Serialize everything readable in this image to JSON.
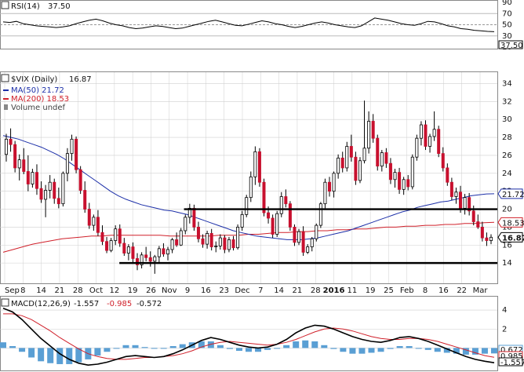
{
  "colors": {
    "up_candle": "#ffffff",
    "down_candle": "#c8102e",
    "candle_outline": "#000000",
    "ma50": "#1c2fa8",
    "ma200": "#d0202a",
    "rsi": "#000000",
    "macd": "#000000",
    "signal": "#d0202a",
    "histogram": "#5a9fd4",
    "support_line": "#000000",
    "grid": "#cfcfcf"
  },
  "rsi_panel": {
    "legend": "RSI(14)",
    "value": "37.50",
    "ylim": [
      10,
      90
    ],
    "yticks": [
      "90",
      "70",
      "50",
      "30",
      "10"
    ],
    "last_tag": "37.50",
    "series": [
      55,
      54,
      56,
      52,
      50,
      48,
      47,
      46,
      45,
      46,
      48,
      52,
      55,
      58,
      60,
      57,
      53,
      50,
      48,
      45,
      43,
      44,
      46,
      48,
      47,
      45,
      43,
      44,
      47,
      50,
      53,
      56,
      58,
      55,
      52,
      49,
      48,
      51,
      54,
      57,
      55,
      52,
      50,
      47,
      45,
      47,
      50,
      53,
      55,
      53,
      50,
      48,
      46,
      45,
      48,
      55,
      62,
      60,
      58,
      55,
      52,
      50,
      49,
      52,
      56,
      55,
      52,
      48,
      46,
      43,
      42,
      40,
      39,
      38,
      37.5
    ]
  },
  "price_panel": {
    "legend_symbol": "$VIX (Daily)",
    "legend_value": "16.87",
    "ma50_legend": "MA(50) 21.72",
    "ma200_legend": "MA(200) 18.53",
    "volume_legend": "Volume undef",
    "ylim": [
      12,
      35
    ],
    "yticks": [
      "34",
      "32",
      "30",
      "28",
      "26",
      "24",
      "22",
      "20",
      "18",
      "16",
      "14"
    ],
    "tags": {
      "ma50": "21.72",
      "ma200": "18.53",
      "last": "16.87"
    },
    "support_lines": [
      {
        "y": 20,
        "from": 0.37,
        "to": 1.0
      },
      {
        "y": 14,
        "from": 0.24,
        "to": 1.0
      }
    ],
    "x_labels": [
      "Sep",
      "8",
      "14",
      "21",
      "28",
      "Oct",
      "12",
      "19",
      "26",
      "Nov",
      "9",
      "16",
      "23",
      "Dec",
      "7",
      "14",
      "21",
      "28",
      "2016",
      "11",
      "19",
      "25",
      "Feb",
      "8",
      "16",
      "22",
      "Mar"
    ],
    "candles": [
      [
        26.1,
        28.4,
        25.3,
        27.8
      ],
      [
        27.8,
        29.0,
        26.4,
        27.2
      ],
      [
        27.2,
        27.6,
        24.1,
        24.6
      ],
      [
        24.6,
        26.1,
        23.2,
        25.5
      ],
      [
        25.5,
        26.8,
        23.9,
        24.2
      ],
      [
        24.2,
        26.0,
        22.0,
        22.8
      ],
      [
        22.8,
        24.5,
        22.4,
        24.1
      ],
      [
        24.1,
        25.0,
        21.6,
        22.3
      ],
      [
        22.3,
        23.1,
        20.7,
        21.1
      ],
      [
        21.1,
        22.7,
        19.1,
        22.1
      ],
      [
        22.1,
        23.8,
        21.2,
        23.0
      ],
      [
        23.0,
        23.4,
        20.6,
        21.2
      ],
      [
        21.2,
        22.4,
        20.1,
        20.6
      ],
      [
        20.6,
        24.2,
        20.3,
        24.0
      ],
      [
        24.0,
        26.8,
        23.1,
        26.2
      ],
      [
        26.2,
        28.3,
        25.4,
        27.8
      ],
      [
        27.8,
        28.1,
        24.0,
        24.4
      ],
      [
        24.4,
        24.8,
        21.7,
        22.1
      ],
      [
        22.1,
        23.1,
        19.6,
        20.0
      ],
      [
        20.0,
        20.7,
        17.8,
        18.2
      ],
      [
        18.2,
        19.4,
        17.6,
        19.1
      ],
      [
        19.1,
        19.9,
        17.0,
        17.4
      ],
      [
        17.4,
        18.2,
        16.0,
        16.4
      ],
      [
        16.4,
        16.9,
        15.1,
        15.4
      ],
      [
        15.4,
        16.8,
        15.2,
        16.5
      ],
      [
        16.5,
        18.2,
        16.0,
        17.8
      ],
      [
        17.8,
        18.3,
        15.8,
        16.2
      ],
      [
        16.2,
        16.8,
        14.8,
        15.1
      ],
      [
        15.1,
        16.1,
        14.3,
        15.8
      ],
      [
        15.8,
        16.3,
        14.0,
        14.5
      ],
      [
        14.5,
        15.1,
        13.2,
        13.8
      ],
      [
        13.8,
        15.2,
        13.4,
        14.9
      ],
      [
        14.9,
        15.8,
        14.2,
        14.6
      ],
      [
        14.6,
        15.3,
        13.6,
        14.2
      ],
      [
        14.2,
        14.9,
        12.8,
        14.7
      ],
      [
        14.7,
        15.9,
        14.1,
        15.6
      ],
      [
        15.6,
        16.2,
        14.7,
        15.0
      ],
      [
        15.0,
        15.8,
        14.3,
        15.5
      ],
      [
        15.5,
        16.8,
        15.1,
        16.6
      ],
      [
        16.6,
        17.4,
        15.8,
        16.0
      ],
      [
        16.0,
        17.9,
        15.9,
        17.6
      ],
      [
        17.6,
        19.4,
        17.2,
        19.1
      ],
      [
        19.1,
        20.6,
        18.4,
        20.1
      ],
      [
        20.1,
        20.5,
        17.6,
        18.0
      ],
      [
        18.0,
        18.6,
        16.3,
        16.7
      ],
      [
        16.7,
        17.2,
        15.7,
        16.1
      ],
      [
        16.1,
        17.6,
        15.6,
        17.3
      ],
      [
        17.3,
        17.8,
        15.4,
        15.8
      ],
      [
        15.8,
        16.4,
        15.2,
        15.9
      ],
      [
        15.9,
        17.2,
        15.5,
        16.8
      ],
      [
        16.8,
        17.1,
        15.1,
        15.5
      ],
      [
        15.5,
        16.9,
        15.2,
        16.6
      ],
      [
        16.6,
        17.0,
        15.4,
        15.7
      ],
      [
        15.7,
        18.3,
        15.5,
        18.0
      ],
      [
        18.0,
        19.8,
        17.6,
        19.4
      ],
      [
        19.4,
        21.6,
        19.1,
        21.3
      ],
      [
        21.3,
        24.2,
        20.8,
        23.6
      ],
      [
        23.6,
        27.0,
        22.7,
        26.4
      ],
      [
        26.4,
        26.8,
        22.5,
        23.0
      ],
      [
        23.0,
        23.4,
        19.2,
        19.6
      ],
      [
        19.6,
        20.3,
        18.4,
        19.0
      ],
      [
        19.0,
        19.4,
        16.8,
        17.2
      ],
      [
        17.2,
        19.8,
        16.9,
        19.5
      ],
      [
        19.5,
        21.9,
        19.1,
        21.4
      ],
      [
        21.4,
        22.2,
        20.2,
        20.6
      ],
      [
        20.6,
        20.9,
        17.6,
        18.0
      ],
      [
        18.0,
        18.3,
        15.9,
        16.3
      ],
      [
        16.3,
        17.8,
        16.0,
        17.5
      ],
      [
        17.5,
        18.1,
        14.8,
        15.2
      ],
      [
        15.2,
        16.1,
        15.0,
        15.8
      ],
      [
        15.8,
        16.9,
        15.3,
        16.7
      ],
      [
        16.7,
        18.4,
        16.4,
        18.2
      ],
      [
        18.2,
        20.8,
        17.9,
        20.6
      ],
      [
        20.6,
        23.4,
        20.1,
        23.0
      ],
      [
        23.0,
        23.6,
        21.4,
        22.0
      ],
      [
        22.0,
        24.2,
        21.3,
        24.0
      ],
      [
        24.0,
        26.1,
        23.4,
        25.7
      ],
      [
        25.7,
        26.4,
        24.1,
        24.6
      ],
      [
        24.6,
        27.5,
        24.2,
        27.0
      ],
      [
        27.0,
        28.3,
        25.3,
        25.8
      ],
      [
        25.8,
        26.4,
        22.7,
        23.2
      ],
      [
        23.2,
        25.8,
        22.9,
        25.4
      ],
      [
        25.4,
        32.1,
        25.1,
        26.8
      ],
      [
        26.8,
        30.9,
        26.2,
        29.8
      ],
      [
        29.8,
        30.6,
        27.4,
        27.9
      ],
      [
        27.9,
        28.3,
        24.3,
        24.8
      ],
      [
        24.8,
        26.6,
        24.2,
        26.3
      ],
      [
        26.3,
        26.8,
        24.6,
        25.1
      ],
      [
        25.1,
        25.7,
        22.8,
        23.3
      ],
      [
        23.3,
        24.5,
        22.4,
        24.1
      ],
      [
        24.1,
        24.6,
        21.7,
        22.2
      ],
      [
        22.2,
        23.6,
        21.6,
        23.3
      ],
      [
        23.3,
        23.8,
        22.1,
        22.5
      ],
      [
        22.5,
        26.1,
        22.2,
        25.8
      ],
      [
        25.8,
        28.3,
        25.4,
        27.9
      ],
      [
        27.9,
        29.8,
        27.1,
        29.4
      ],
      [
        29.4,
        29.9,
        26.6,
        27.0
      ],
      [
        27.0,
        28.4,
        26.3,
        28.1
      ],
      [
        28.1,
        30.9,
        27.6,
        28.9
      ],
      [
        28.9,
        29.3,
        25.8,
        26.2
      ],
      [
        26.2,
        26.9,
        24.2,
        24.6
      ],
      [
        24.6,
        25.1,
        22.6,
        23.0
      ],
      [
        23.0,
        23.5,
        21.0,
        21.4
      ],
      [
        21.4,
        22.4,
        20.6,
        21.9
      ],
      [
        21.9,
        22.6,
        19.6,
        20.1
      ],
      [
        20.1,
        21.7,
        19.4,
        21.3
      ],
      [
        21.3,
        21.8,
        19.3,
        19.8
      ],
      [
        19.8,
        20.4,
        18.2,
        18.6
      ],
      [
        18.6,
        19.4,
        17.8,
        18.0
      ],
      [
        18.0,
        18.6,
        16.4,
        16.8
      ],
      [
        16.8,
        17.4,
        15.9,
        16.5
      ],
      [
        16.5,
        17.2,
        16.1,
        16.87
      ]
    ],
    "ma50": [
      28.2,
      28.0,
      27.8,
      27.5,
      27.2,
      26.9,
      26.5,
      26.1,
      25.6,
      25.0,
      24.4,
      23.8,
      23.2,
      22.6,
      22.0,
      21.5,
      21.1,
      20.8,
      20.5,
      20.3,
      20.1,
      19.9,
      19.8,
      19.6,
      19.4,
      19.1,
      18.8,
      18.5,
      18.2,
      17.9,
      17.6,
      17.4,
      17.2,
      17.0,
      16.9,
      16.8,
      16.7,
      16.6,
      16.6,
      16.6,
      16.7,
      16.8,
      17.0,
      17.2,
      17.4,
      17.6,
      17.9,
      18.2,
      18.5,
      18.8,
      19.1,
      19.4,
      19.7,
      19.9,
      20.2,
      20.4,
      20.6,
      20.8,
      20.9,
      21.1,
      21.3,
      21.5,
      21.6,
      21.7,
      21.72
    ],
    "ma200": [
      15.2,
      15.5,
      15.8,
      16.1,
      16.3,
      16.5,
      16.7,
      16.8,
      16.9,
      17.0,
      17.0,
      17.1,
      17.1,
      17.1,
      17.1,
      17.1,
      17.1,
      17.0,
      17.0,
      17.0,
      17.0,
      17.0,
      17.1,
      17.1,
      17.1,
      17.2,
      17.2,
      17.3,
      17.4,
      17.4,
      17.5,
      17.5,
      17.6,
      17.6,
      17.7,
      17.7,
      17.8,
      17.8,
      17.9,
      18.0,
      18.0,
      18.1,
      18.1,
      18.2,
      18.2,
      18.3,
      18.3,
      18.4,
      18.4,
      18.5,
      18.53
    ]
  },
  "macd_panel": {
    "legend": "MACD(12,26,9)",
    "macd_value": "-1.557",
    "signal_value": "-0.985",
    "hist_value": "-0.572",
    "ylim": [
      -2.2,
      5.0
    ],
    "yticks": [
      "4",
      "2"
    ],
    "tags": [
      "0.672",
      "0.985",
      "-1.557"
    ],
    "macd": [
      4.2,
      3.8,
      3.0,
      2.0,
      1.0,
      0.2,
      -0.6,
      -1.2,
      -1.6,
      -1.8,
      -1.7,
      -1.5,
      -1.2,
      -0.9,
      -0.8,
      -0.9,
      -1.0,
      -0.9,
      -0.6,
      -0.2,
      0.3,
      0.8,
      1.1,
      0.9,
      0.6,
      0.3,
      0.1,
      0.0,
      0.1,
      0.4,
      0.9,
      1.6,
      2.1,
      2.4,
      2.3,
      2.0,
      1.6,
      1.2,
      0.9,
      0.7,
      0.6,
      0.8,
      1.1,
      1.2,
      1.0,
      0.7,
      0.3,
      -0.1,
      -0.5,
      -0.9,
      -1.2,
      -1.4,
      -1.557
    ],
    "signal": [
      3.6,
      3.6,
      3.4,
      3.0,
      2.4,
      1.8,
      1.1,
      0.5,
      -0.1,
      -0.6,
      -0.9,
      -1.1,
      -1.2,
      -1.2,
      -1.1,
      -1.0,
      -1.0,
      -0.9,
      -0.8,
      -0.6,
      -0.3,
      0.1,
      0.4,
      0.6,
      0.7,
      0.6,
      0.5,
      0.4,
      0.3,
      0.4,
      0.6,
      0.9,
      1.3,
      1.7,
      2.0,
      2.1,
      2.0,
      1.8,
      1.5,
      1.2,
      1.0,
      0.9,
      0.9,
      1.0,
      1.0,
      0.9,
      0.7,
      0.4,
      0.1,
      -0.2,
      -0.5,
      -0.8,
      -0.985
    ]
  }
}
